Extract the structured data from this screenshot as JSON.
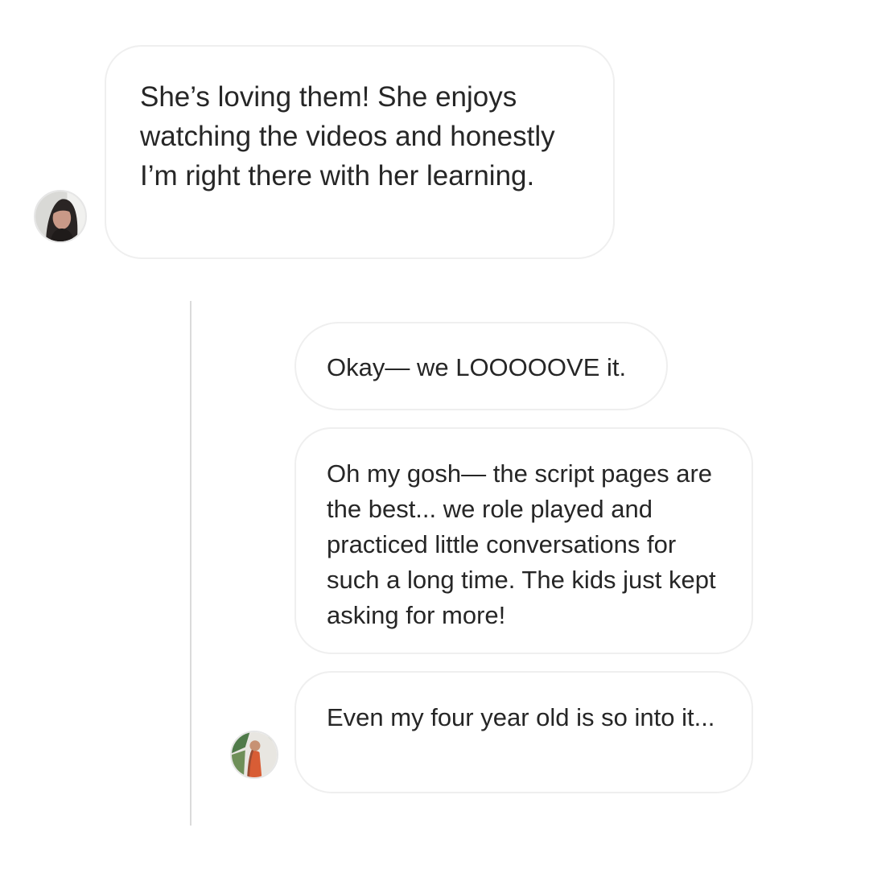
{
  "thread": {
    "messages": [
      {
        "author": "other",
        "avatar_icon": "user-avatar-icon",
        "text": "She’s loving them! She enjoys watching the videos and honestly I’m right there with her learning."
      },
      {
        "author": "reply",
        "text": "Okay— we LOOOOOVE it."
      },
      {
        "author": "reply",
        "text": "Oh my gosh— the script pages are the best... we role played and practiced little conversations for such a long time. The kids just kept asking for more!"
      },
      {
        "author": "reply",
        "avatar_icon": "user-avatar-icon",
        "text": "Even my four year old is so into it..."
      }
    ]
  },
  "colors": {
    "background": "#ffffff",
    "bubble_border": "#efefef",
    "text": "#262626",
    "thread_line": "#dbdbdb"
  }
}
